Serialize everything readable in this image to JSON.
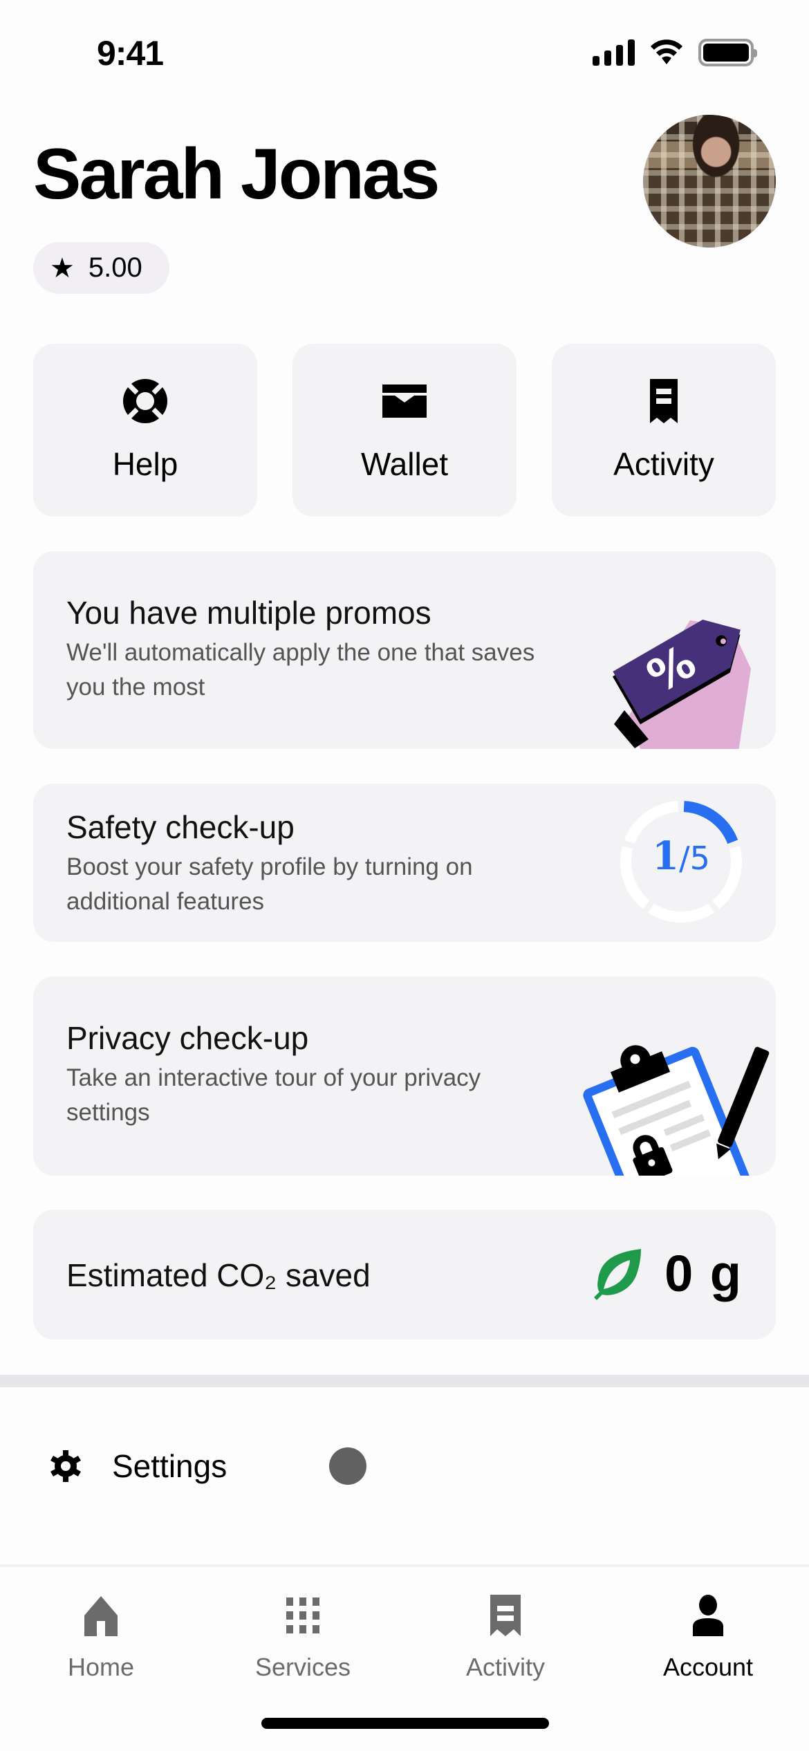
{
  "status_bar": {
    "time": "9:41",
    "icons": [
      "signal-icon",
      "wifi-icon",
      "battery-icon"
    ]
  },
  "profile": {
    "name": "Sarah Jonas",
    "rating": "5.00",
    "rating_icon": "star-icon",
    "avatar": "profile-photo"
  },
  "quick_actions": [
    {
      "label": "Help",
      "icon": "lifebuoy-icon"
    },
    {
      "label": "Wallet",
      "icon": "wallet-icon"
    },
    {
      "label": "Activity",
      "icon": "receipt-icon"
    }
  ],
  "cards": {
    "promos": {
      "title": "You have multiple promos",
      "description": "We'll automatically apply the one that saves you the most",
      "illustration": "price-tag-illustration",
      "symbol": "%"
    },
    "safety": {
      "title": "Safety check-up",
      "description": "Boost your safety profile by turning on additional features",
      "progress_completed": 1,
      "progress_total": 5,
      "progress_label_num": "1",
      "progress_label_den": "/5"
    },
    "privacy": {
      "title": "Privacy check-up",
      "description": "Take an interactive tour of your privacy settings",
      "illustration": "clipboard-lock-illustration"
    },
    "co2": {
      "title": "Estimated CO₂ saved",
      "value": "0 g",
      "icon": "leaf-icon"
    }
  },
  "settings": {
    "label": "Settings",
    "icon": "gear-icon"
  },
  "bottom_nav": {
    "active": "Account",
    "items": [
      {
        "label": "Home",
        "icon": "home-icon"
      },
      {
        "label": "Services",
        "icon": "grid-icon"
      },
      {
        "label": "Activity",
        "icon": "receipt-icon"
      },
      {
        "label": "Account",
        "icon": "person-icon"
      }
    ]
  },
  "colors": {
    "accent_blue": "#276ef1",
    "leaf_green": "#1f9a4a",
    "tag_purple": "#46307a",
    "tag_pink": "#e0aed4",
    "card_bg": "#f3f2f5",
    "inactive_gray": "#6b6b6b"
  }
}
